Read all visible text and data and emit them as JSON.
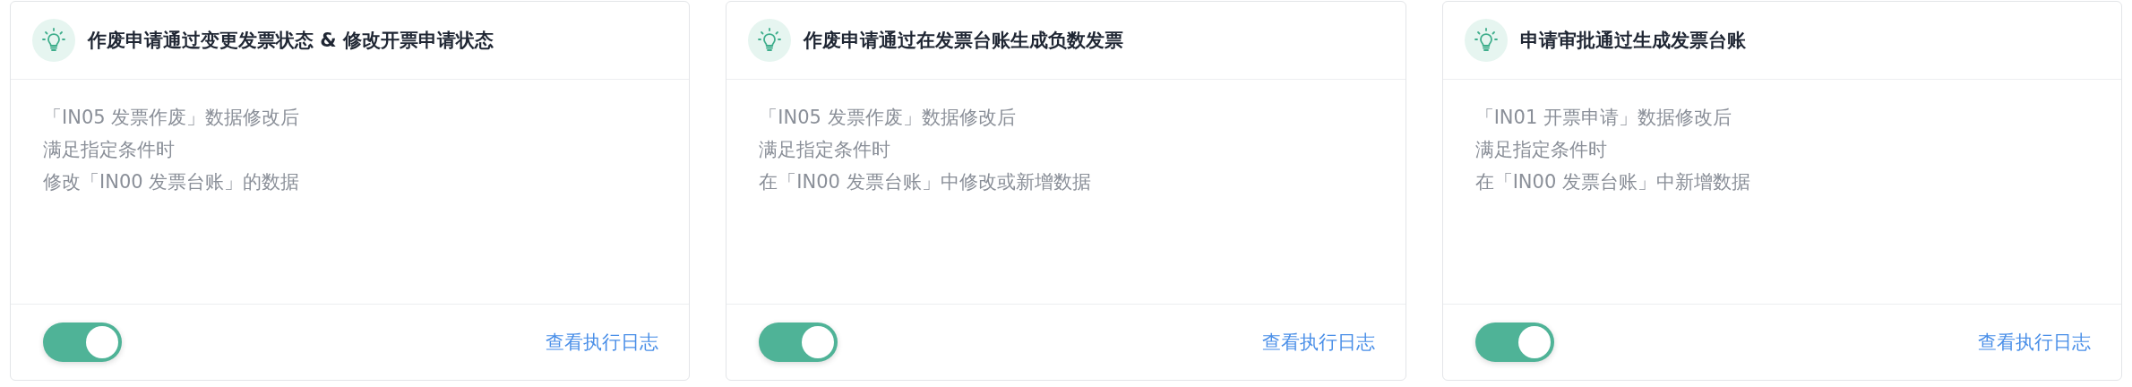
{
  "cards": [
    {
      "title": "作废申请通过变更发票状态 & 修改开票申请状态",
      "lines": [
        "「IN05 发票作废」数据修改后",
        "满足指定条件时",
        "修改「IN00 发票台账」的数据"
      ],
      "enabled": true,
      "link": "查看执行日志"
    },
    {
      "title": "作废申请通过在发票台账生成负数发票",
      "lines": [
        "「IN05 发票作废」数据修改后",
        "满足指定条件时",
        "在「IN00 发票台账」中修改或新增数据"
      ],
      "enabled": true,
      "link": "查看执行日志"
    },
    {
      "title": "申请审批通过生成发票台账",
      "lines": [
        "「IN01 开票申请」数据修改后",
        "满足指定条件时",
        "在「IN00 发票台账」中新增数据"
      ],
      "enabled": true,
      "link": "查看执行日志"
    }
  ]
}
